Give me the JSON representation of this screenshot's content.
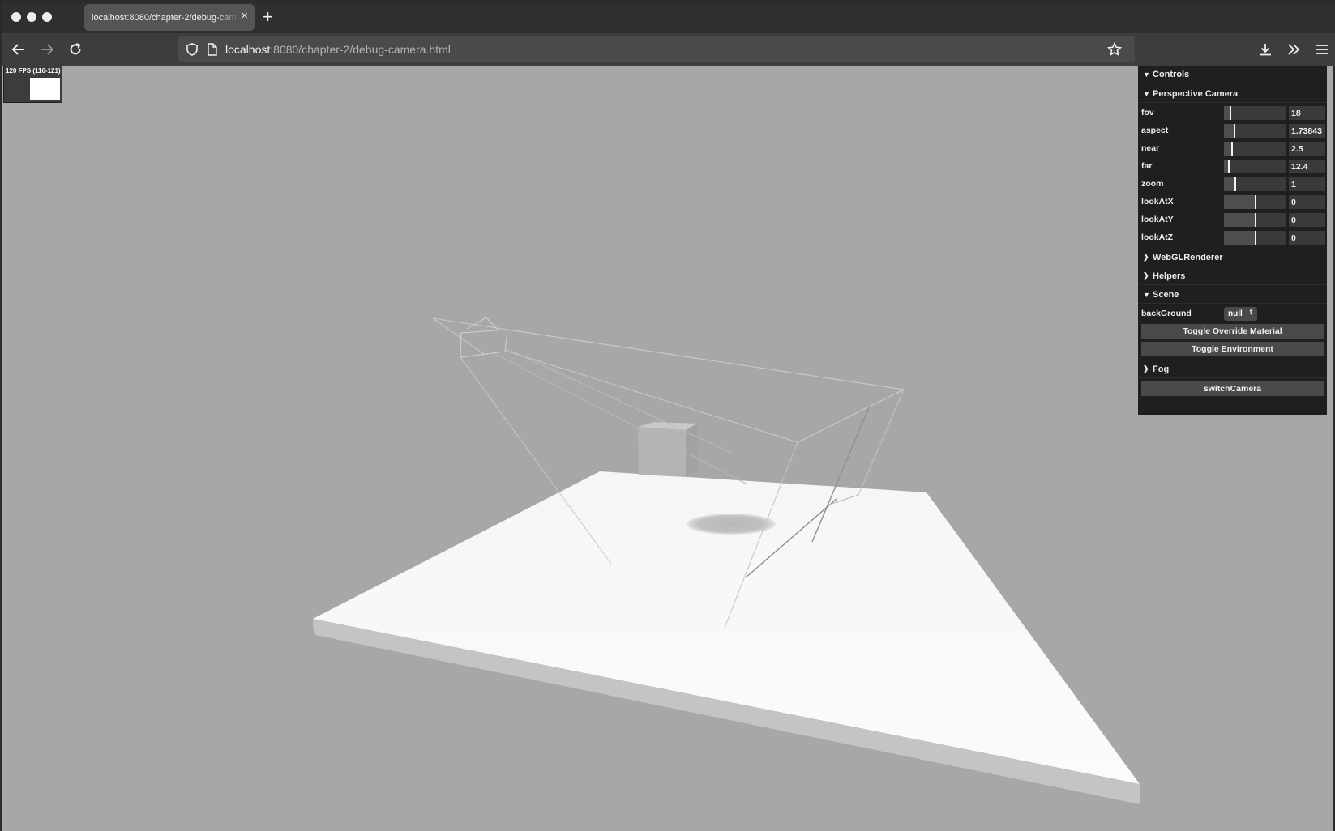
{
  "browser": {
    "tab_title": "localhost:8080/chapter-2/debug-camera.html",
    "tab_close": "×",
    "new_tab": "+",
    "url_host": "localhost",
    "url_rest": ":8080/chapter-2/debug-camera.html"
  },
  "stats": {
    "label": "120 FPS (116-121)"
  },
  "gui": {
    "controls_title": "Controls",
    "perspective_title": "Perspective Camera",
    "params": [
      {
        "label": "fov",
        "value": "18",
        "fraction": 0.1
      },
      {
        "label": "aspect",
        "value": "1.73843",
        "fraction": 0.17
      },
      {
        "label": "near",
        "value": "2.5",
        "fraction": 0.13
      },
      {
        "label": "far",
        "value": "12.4",
        "fraction": 0.08
      },
      {
        "label": "zoom",
        "value": "1",
        "fraction": 0.18
      },
      {
        "label": "lookAtX",
        "value": "0",
        "fraction": 0.5
      },
      {
        "label": "lookAtY",
        "value": "0",
        "fraction": 0.5
      },
      {
        "label": "lookAtZ",
        "value": "0",
        "fraction": 0.5
      }
    ],
    "webgl_title": "WebGLRenderer",
    "helpers_title": "Helpers",
    "scene_title": "Scene",
    "background_label": "backGround",
    "background_value": "null",
    "toggle_override": "Toggle Override Material",
    "toggle_environment": "Toggle Environment",
    "fog_title": "Fog",
    "switch_camera": "switchCamera"
  }
}
